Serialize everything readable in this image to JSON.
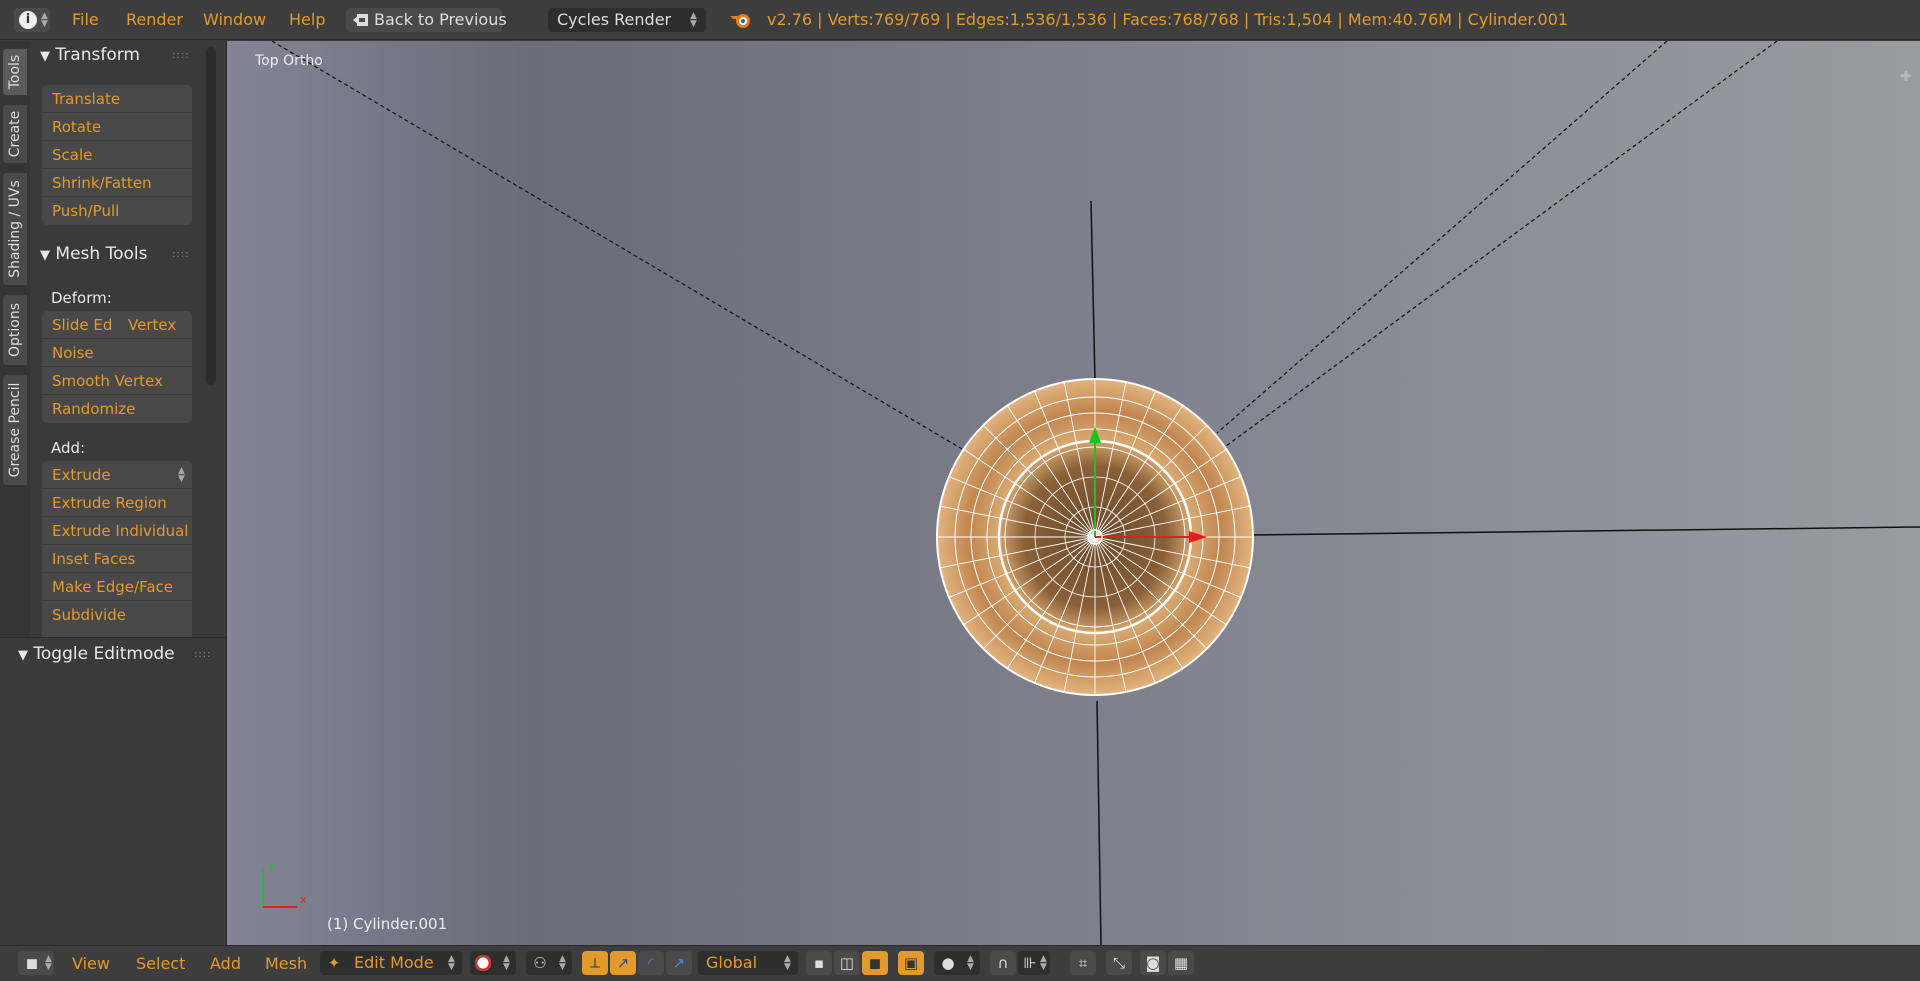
{
  "topbar": {
    "menu": [
      "File",
      "Render",
      "Window",
      "Help"
    ],
    "back_button": "Back to Previous",
    "render_engine": "Cycles Render",
    "stats": "v2.76 | Verts:769/769 | Edges:1,536/1,536 | Faces:768/768 | Tris:1,504 | Mem:40.76M | Cylinder.001"
  },
  "tabs": [
    "Tools",
    "Create",
    "Shading / UVs",
    "Options",
    "Grease Pencil"
  ],
  "tool_panel": {
    "transform": {
      "title": "Transform",
      "buttons": [
        "Translate",
        "Rotate",
        "Scale",
        "Shrink/Fatten",
        "Push/Pull"
      ]
    },
    "mesh_tools": {
      "title": "Mesh Tools",
      "deform_label": "Deform:",
      "deform_row1": [
        "Slide Ed",
        "Vertex"
      ],
      "deform_buttons": [
        "Noise",
        "Smooth Vertex",
        "Randomize"
      ],
      "add_label": "Add:",
      "add_buttons": [
        "Extrude",
        "Extrude Region",
        "Extrude Individual",
        "Inset Faces",
        "Make Edge/Face",
        "Subdivide"
      ]
    }
  },
  "lower_panel": {
    "title": "Toggle Editmode"
  },
  "viewport": {
    "view_name": "Top Ortho",
    "object_label": "(1) Cylinder.001",
    "axis_x": "x",
    "axis_y": "y"
  },
  "bottombar": {
    "menu": [
      "View",
      "Select",
      "Add",
      "Mesh"
    ],
    "mode": "Edit Mode",
    "orientation": "Global"
  },
  "colors": {
    "accent": "#e39a2c",
    "mesh_wire": "#ffffff",
    "mesh_face": "#c08a4c",
    "x_axis": "#e02020",
    "y_axis": "#20c020"
  }
}
